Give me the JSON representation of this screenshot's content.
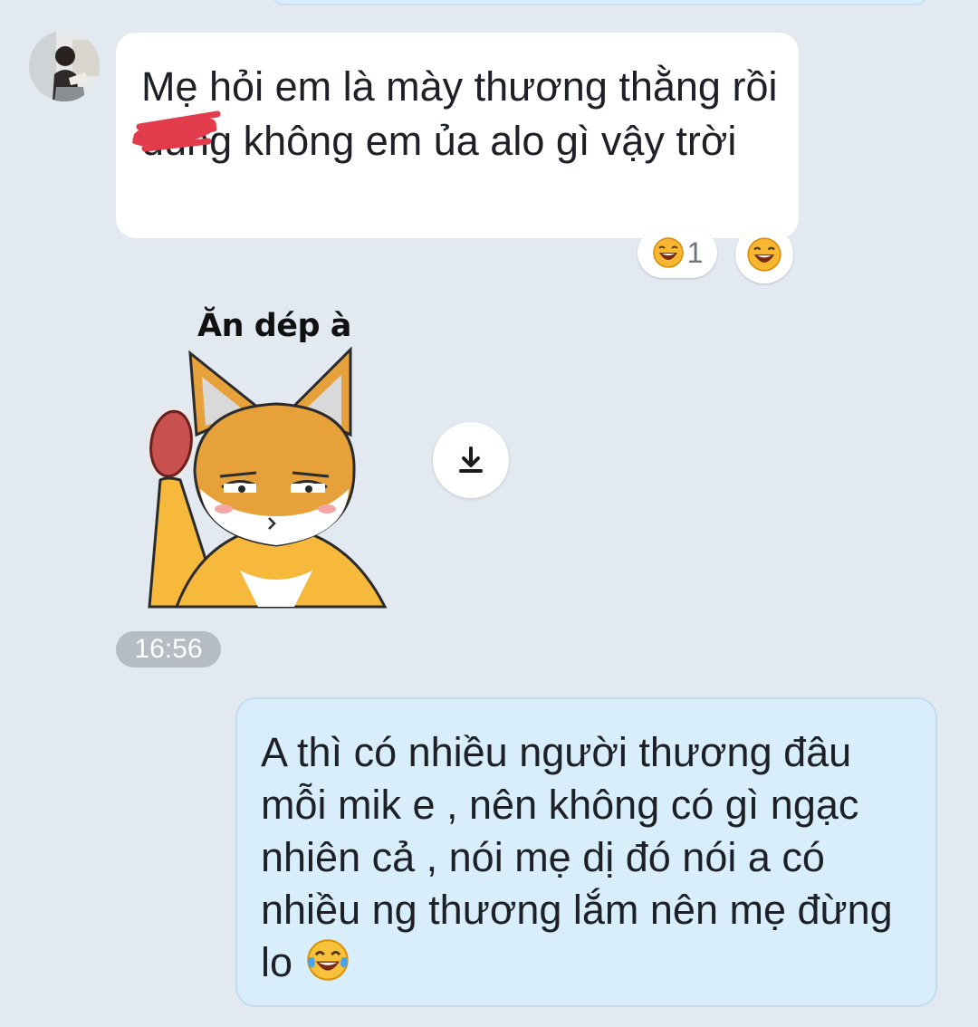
{
  "incoming_message": {
    "text": "Mẹ hỏi em là mày thương thằng  rồi đúng không em ủa alo gì vậy trời"
  },
  "reactions": {
    "count": "1",
    "emoji_icon": "laughing-face-icon",
    "add_icon": "laughing-face-icon"
  },
  "sticker": {
    "caption": "Ăn dép à"
  },
  "download_icon": "download-icon",
  "timestamp": "16:56",
  "outgoing_message": {
    "text": "A thì có nhiều người thương đâu mỗi mik e , nên không có gì ngạc nhiên cả , nói mẹ dị đó nói a có nhiều ng thương lắm nên mẹ đừng lo",
    "emoji_icon": "tears-of-joy-icon"
  },
  "colors": {
    "background": "#e2e9f1",
    "incoming_bubble": "#ffffff",
    "outgoing_bubble": "#d8eefb",
    "timestamp_badge": "#b6bcc3",
    "redaction": "#e23b4c"
  }
}
